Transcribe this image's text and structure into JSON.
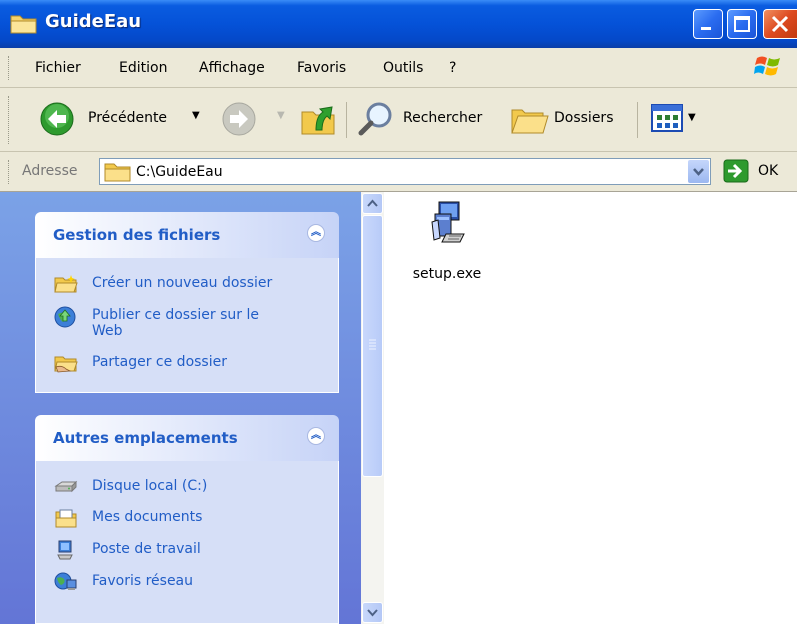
{
  "window": {
    "title": "GuideEau",
    "title_icon": "folder-icon",
    "controls": [
      "minimize-icon",
      "maximize-icon",
      "close-icon"
    ]
  },
  "menubar": {
    "items": [
      "Fichier",
      "Edition",
      "Affichage",
      "Favoris",
      "Outils",
      "?"
    ],
    "logo": "windows-logo-icon"
  },
  "toolbar": {
    "back_label": "Précédente",
    "search_label": "Rechercher",
    "folders_label": "Dossiers"
  },
  "address": {
    "label": "Adresse",
    "path": "C:\\GuideEau",
    "go_label": "OK"
  },
  "tasks": {
    "file_panel": {
      "title": "Gestion des fichiers",
      "items": [
        {
          "label": "Créer un nouveau dossier",
          "icon": "new-folder-icon"
        },
        {
          "label": "Publier ce dossier sur le Web",
          "icon": "publish-web-icon"
        },
        {
          "label": "Partager ce dossier",
          "icon": "share-folder-icon"
        }
      ]
    },
    "places_panel": {
      "title": "Autres emplacements",
      "items": [
        {
          "label": "Disque local (C:)",
          "icon": "local-disk-icon"
        },
        {
          "label": "Mes documents",
          "icon": "my-documents-icon"
        },
        {
          "label": "Poste de travail",
          "icon": "my-computer-icon"
        },
        {
          "label": "Favoris réseau",
          "icon": "network-places-icon"
        }
      ]
    }
  },
  "files": [
    {
      "name": "setup.exe",
      "icon": "setup-installer-icon"
    }
  ],
  "colors": {
    "titlebar": "#0552d8",
    "task_link": "#215dc6",
    "left_pane_top": "#7ba2e7",
    "left_pane_bottom": "#6375d6",
    "panel_body": "#d6dff7"
  }
}
